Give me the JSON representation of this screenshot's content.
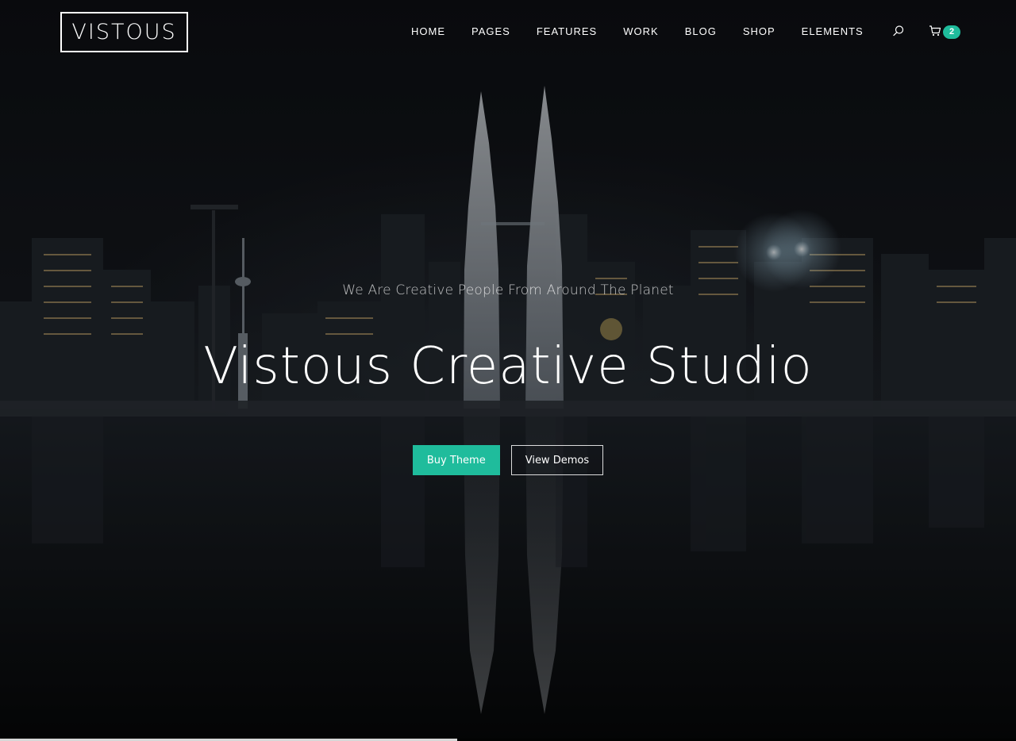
{
  "brand": {
    "logo_text": "VISTOUS"
  },
  "nav": {
    "items": [
      {
        "label": "HOME"
      },
      {
        "label": "PAGES"
      },
      {
        "label": "FEATURES"
      },
      {
        "label": "WORK"
      },
      {
        "label": "BLOG"
      },
      {
        "label": "SHOP"
      },
      {
        "label": "ELEMENTS"
      }
    ],
    "search_icon": "search-icon",
    "cart_icon": "cart-icon",
    "cart_count": "2"
  },
  "hero": {
    "tagline": "We Are Creative People From Around The Planet",
    "title": "Vistous Creative Studio",
    "primary_button": "Buy Theme",
    "secondary_button": "View Demos",
    "background": "night city skyline with twin towers reflected in water"
  },
  "slider": {
    "progress_fraction": 0.45
  },
  "colors": {
    "accent": "#1fbc9c",
    "text": "#ffffff",
    "background": "#0a0c0f"
  }
}
